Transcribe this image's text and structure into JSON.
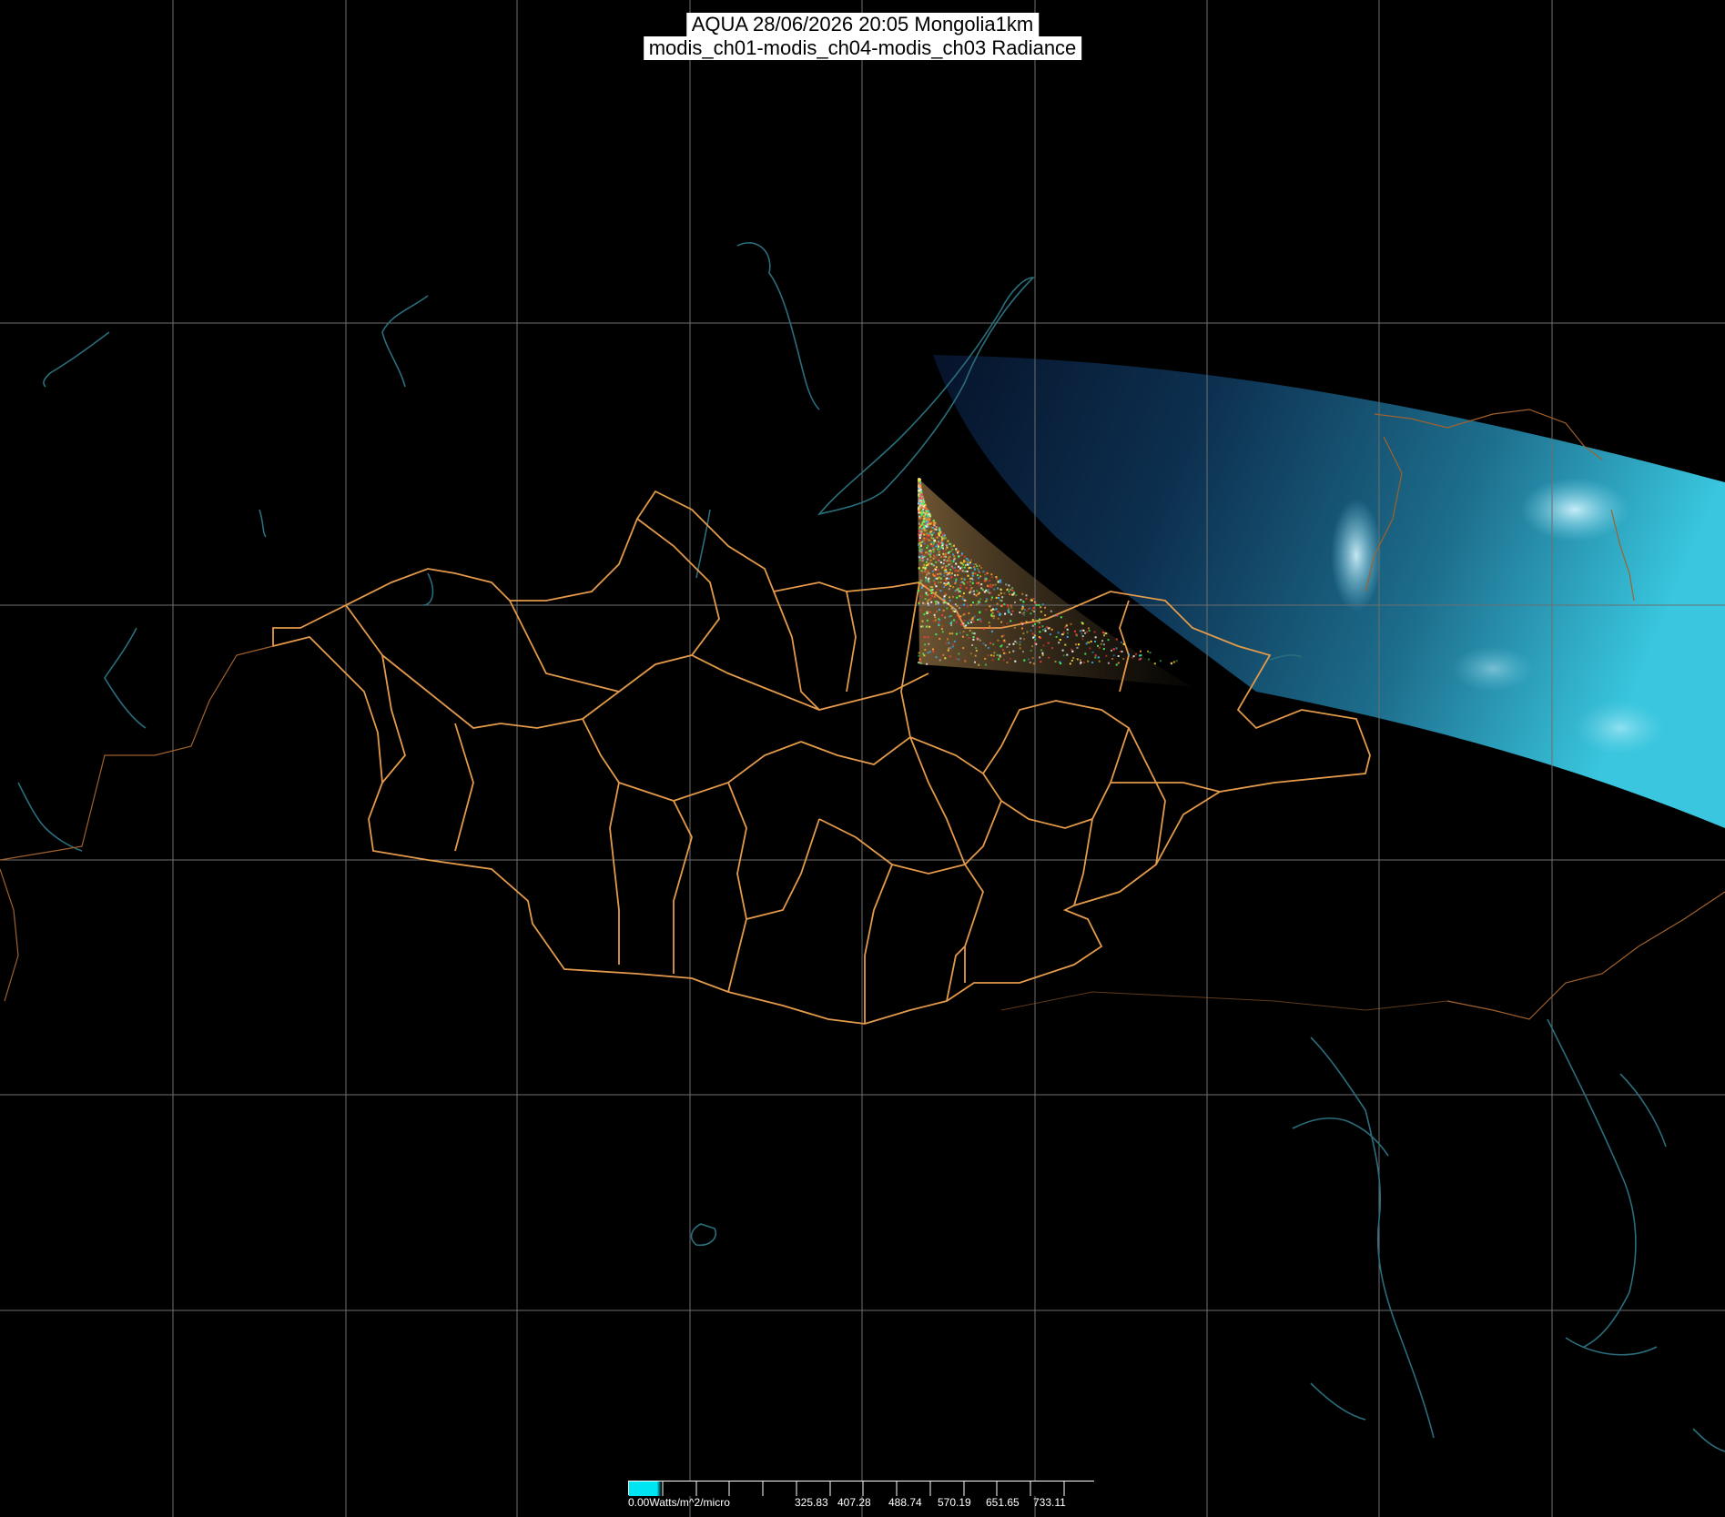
{
  "title": {
    "line1": "AQUA 28/06/2026 20:05 Mongolia1km",
    "line2": "modis_ch01-modis_ch04-modis_ch03 Radiance"
  },
  "colors": {
    "background": "#000000",
    "graticule": "#6e6e6e",
    "coastline": "#2a6e7c",
    "borders": "#e39a4a",
    "swath_dark": "#0b1d33",
    "swath_light": "#33c7dd",
    "colorbar_start": "#00e5f2"
  },
  "colorbar": {
    "unit_label": "0.00Watts/m^2/micro",
    "tick_labels": [
      "325.83",
      "407.28",
      "488.74",
      "570.19",
      "651.65",
      "733.11"
    ]
  },
  "legend_placement": "bottom-center",
  "title_placement": "top-center"
}
